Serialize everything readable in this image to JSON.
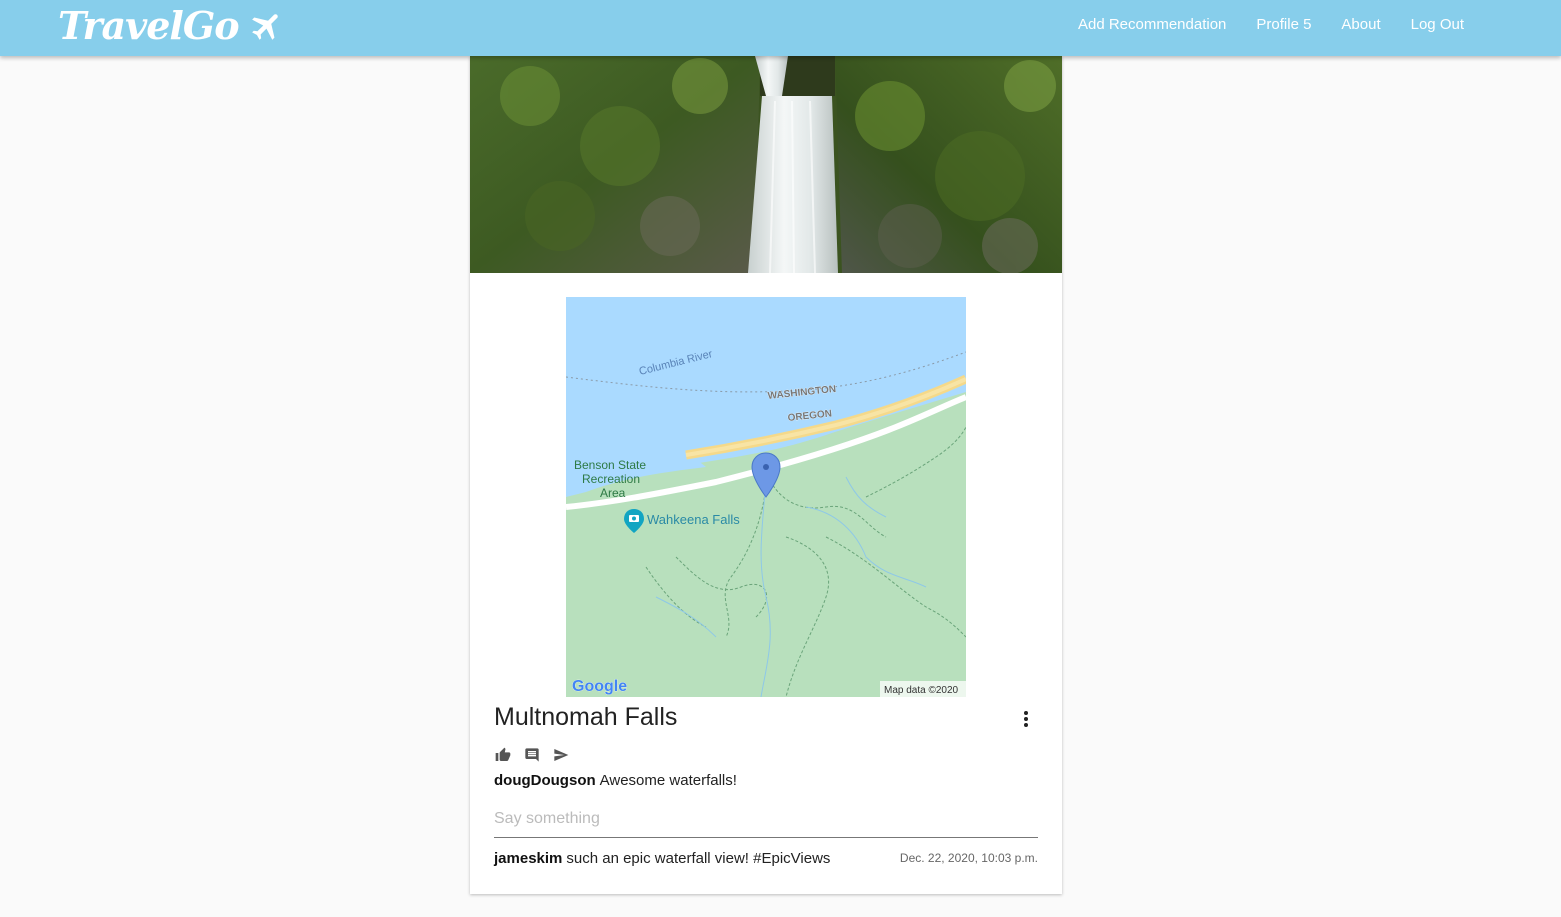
{
  "navbar": {
    "brand": "TravelGo",
    "links": [
      "Add Recommendation",
      "Profile 5",
      "About",
      "Log Out"
    ]
  },
  "map": {
    "labels": {
      "river": "Columbia River",
      "state_north": "WASHINGTON",
      "state_south": "OREGON",
      "park_line1": "Benson State",
      "park_line2": "Recreation",
      "park_line3": "Area",
      "poi": "Wahkeena Falls",
      "attribution": "Map data ©2020",
      "logo": "Google"
    }
  },
  "post": {
    "title": "Multnomah Falls",
    "caption": {
      "user": "dougDougson",
      "text": "Awesome waterfalls!"
    },
    "comment_placeholder": "Say something",
    "comments": [
      {
        "user": "jameskim",
        "text": "such an epic waterfall view! #EpicViews",
        "timestamp": "Dec. 22, 2020, 10:03 p.m."
      }
    ]
  },
  "icons": {
    "brand": "airplane-icon",
    "like": "thumbs-up-icon",
    "comment": "comment-icon",
    "share": "send-icon",
    "menu": "more-vertical-icon"
  },
  "colors": {
    "navbar": "#87ceeb",
    "background": "#fafafa",
    "water": "#aadaff",
    "land": "#b8e0bd",
    "marker": "#6d98e6"
  }
}
